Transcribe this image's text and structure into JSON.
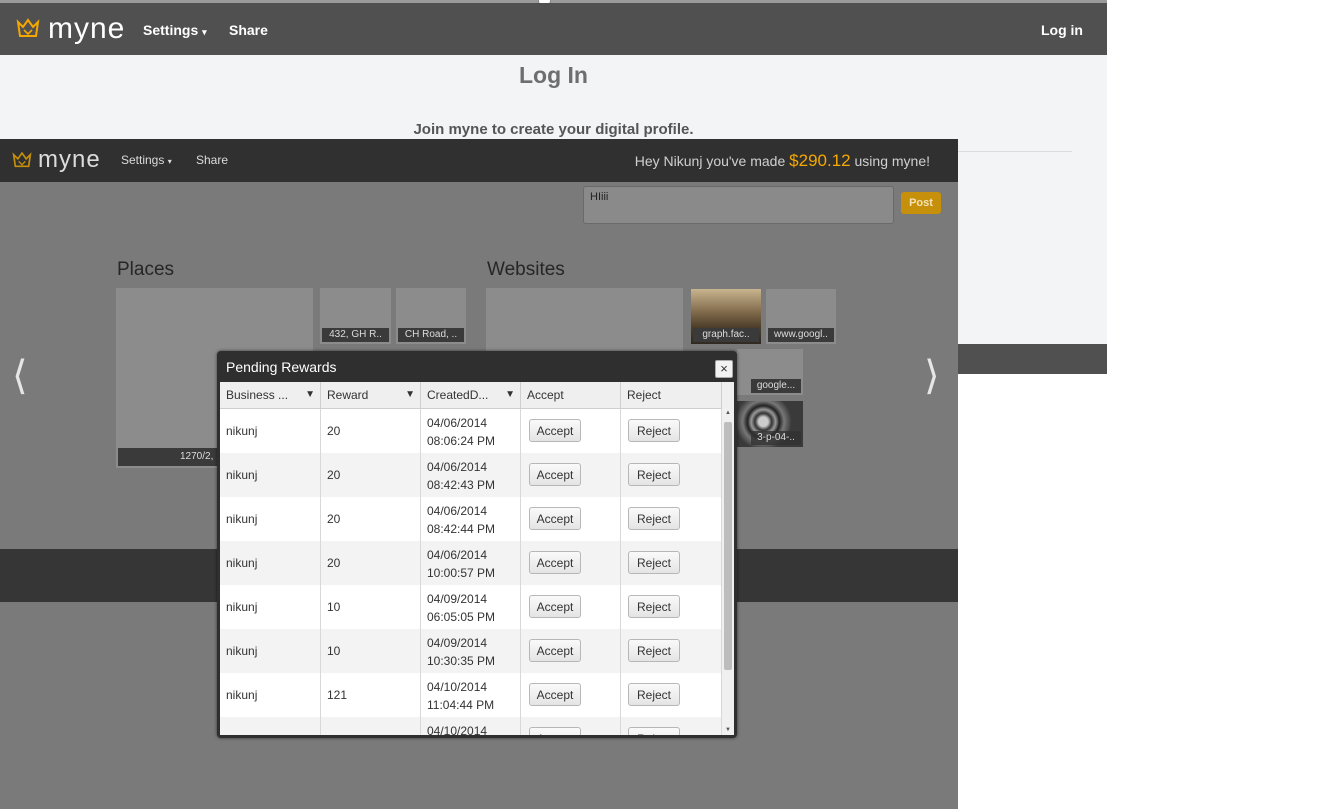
{
  "back_window": {
    "brand": "myne",
    "nav": {
      "settings": "Settings",
      "share": "Share",
      "login": "Log in"
    },
    "title": "Log In",
    "subtitle": "Join myne to create your digital profile."
  },
  "front_window": {
    "brand": "myne",
    "nav": {
      "settings": "Settings",
      "share": "Share"
    },
    "greeting": {
      "prefix": "Hey Nikunj you've made ",
      "currency": "$",
      "amount": "290.12",
      "suffix": " using myne!"
    },
    "post": {
      "text": "HIiii",
      "button": "Post"
    },
    "places": {
      "title": "Places",
      "tiles": [
        "1270/2, 1",
        "432, GH R..",
        "CH Road, .."
      ]
    },
    "websites": {
      "title": "Websites",
      "tiles": [
        "graph.fac..",
        "www.googl..",
        "google...",
        "3-p-04-.."
      ]
    }
  },
  "modal": {
    "title": "Pending Rewards",
    "close": "×",
    "columns": [
      "Business ...",
      "Reward",
      "CreatedD...",
      "Accept",
      "Reject"
    ],
    "accept_label": "Accept",
    "reject_label": "Reject",
    "rows": [
      {
        "business": "nikunj",
        "reward": "20",
        "date": "04/06/2014",
        "time": "08:06:24 PM"
      },
      {
        "business": "nikunj",
        "reward": "20",
        "date": "04/06/2014",
        "time": "08:42:43 PM"
      },
      {
        "business": "nikunj",
        "reward": "20",
        "date": "04/06/2014",
        "time": "08:42:44 PM"
      },
      {
        "business": "nikunj",
        "reward": "20",
        "date": "04/06/2014",
        "time": "10:00:57 PM"
      },
      {
        "business": "nikunj",
        "reward": "10",
        "date": "04/09/2014",
        "time": "06:05:05 PM"
      },
      {
        "business": "nikunj",
        "reward": "10",
        "date": "04/09/2014",
        "time": "10:30:35 PM"
      },
      {
        "business": "nikunj",
        "reward": "121",
        "date": "04/10/2014",
        "time": "11:04:44 PM"
      },
      {
        "business": "",
        "reward": "",
        "date": "04/10/2014",
        "time": ""
      }
    ]
  }
}
